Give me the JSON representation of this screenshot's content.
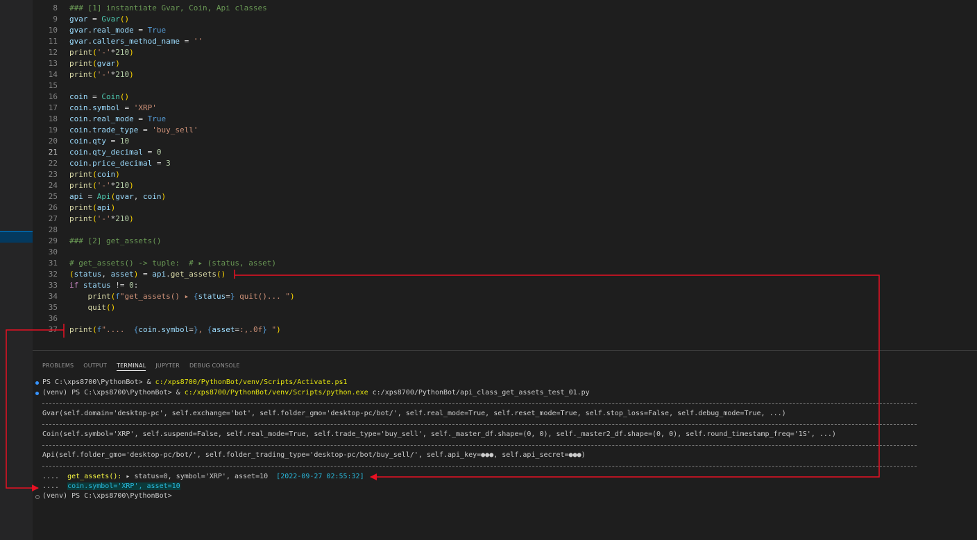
{
  "editor": {
    "active_line": "21",
    "lines": [
      {
        "n": "8",
        "tokens": [
          [
            "c",
            "### [1] instantiate Gvar, Coin, Api classes"
          ]
        ]
      },
      {
        "n": "9",
        "tokens": [
          [
            "v",
            "gvar"
          ],
          [
            "p",
            " = "
          ],
          [
            "cls",
            "Gvar"
          ],
          [
            "y",
            "()"
          ]
        ]
      },
      {
        "n": "10",
        "tokens": [
          [
            "v",
            "gvar"
          ],
          [
            "p",
            "."
          ],
          [
            "v",
            "real_mode"
          ],
          [
            "p",
            " = "
          ],
          [
            "b",
            "True"
          ]
        ]
      },
      {
        "n": "11",
        "tokens": [
          [
            "v",
            "gvar"
          ],
          [
            "p",
            "."
          ],
          [
            "v",
            "callers_method_name"
          ],
          [
            "p",
            " = "
          ],
          [
            "s",
            "''"
          ]
        ]
      },
      {
        "n": "12",
        "tokens": [
          [
            "f",
            "print"
          ],
          [
            "y",
            "("
          ],
          [
            "s",
            "'-'"
          ],
          [
            "p",
            "*"
          ],
          [
            "n",
            "210"
          ],
          [
            "y",
            ")"
          ]
        ]
      },
      {
        "n": "13",
        "tokens": [
          [
            "f",
            "print"
          ],
          [
            "y",
            "("
          ],
          [
            "v",
            "gvar"
          ],
          [
            "y",
            ")"
          ]
        ]
      },
      {
        "n": "14",
        "tokens": [
          [
            "f",
            "print"
          ],
          [
            "y",
            "("
          ],
          [
            "s",
            "'-'"
          ],
          [
            "p",
            "*"
          ],
          [
            "n",
            "210"
          ],
          [
            "y",
            ")"
          ]
        ]
      },
      {
        "n": "15",
        "tokens": []
      },
      {
        "n": "16",
        "tokens": [
          [
            "v",
            "coin"
          ],
          [
            "p",
            " = "
          ],
          [
            "cls",
            "Coin"
          ],
          [
            "y",
            "()"
          ]
        ]
      },
      {
        "n": "17",
        "tokens": [
          [
            "v",
            "coin"
          ],
          [
            "p",
            "."
          ],
          [
            "v",
            "symbol"
          ],
          [
            "p",
            " = "
          ],
          [
            "s",
            "'XRP'"
          ]
        ]
      },
      {
        "n": "18",
        "tokens": [
          [
            "v",
            "coin"
          ],
          [
            "p",
            "."
          ],
          [
            "v",
            "real_mode"
          ],
          [
            "p",
            " = "
          ],
          [
            "b",
            "True"
          ]
        ]
      },
      {
        "n": "19",
        "tokens": [
          [
            "v",
            "coin"
          ],
          [
            "p",
            "."
          ],
          [
            "v",
            "trade_type"
          ],
          [
            "p",
            " = "
          ],
          [
            "s",
            "'buy_sell'"
          ]
        ]
      },
      {
        "n": "20",
        "tokens": [
          [
            "v",
            "coin"
          ],
          [
            "p",
            "."
          ],
          [
            "v",
            "qty"
          ],
          [
            "p",
            " = "
          ],
          [
            "n",
            "10"
          ]
        ]
      },
      {
        "n": "21",
        "tokens": [
          [
            "v",
            "coin"
          ],
          [
            "p",
            "."
          ],
          [
            "v",
            "qty_decimal"
          ],
          [
            "p",
            " = "
          ],
          [
            "n",
            "0"
          ]
        ]
      },
      {
        "n": "22",
        "tokens": [
          [
            "v",
            "coin"
          ],
          [
            "p",
            "."
          ],
          [
            "v",
            "price_decimal"
          ],
          [
            "p",
            " = "
          ],
          [
            "n",
            "3"
          ]
        ]
      },
      {
        "n": "23",
        "tokens": [
          [
            "f",
            "print"
          ],
          [
            "y",
            "("
          ],
          [
            "v",
            "coin"
          ],
          [
            "y",
            ")"
          ]
        ]
      },
      {
        "n": "24",
        "tokens": [
          [
            "f",
            "print"
          ],
          [
            "y",
            "("
          ],
          [
            "s",
            "'-'"
          ],
          [
            "p",
            "*"
          ],
          [
            "n",
            "210"
          ],
          [
            "y",
            ")"
          ]
        ]
      },
      {
        "n": "25",
        "tokens": [
          [
            "v",
            "api"
          ],
          [
            "p",
            " = "
          ],
          [
            "cls",
            "Api"
          ],
          [
            "y",
            "("
          ],
          [
            "v",
            "gvar"
          ],
          [
            "p",
            ", "
          ],
          [
            "v",
            "coin"
          ],
          [
            "y",
            ")"
          ]
        ]
      },
      {
        "n": "26",
        "tokens": [
          [
            "f",
            "print"
          ],
          [
            "y",
            "("
          ],
          [
            "v",
            "api"
          ],
          [
            "y",
            ")"
          ]
        ]
      },
      {
        "n": "27",
        "tokens": [
          [
            "f",
            "print"
          ],
          [
            "y",
            "("
          ],
          [
            "s",
            "'-'"
          ],
          [
            "p",
            "*"
          ],
          [
            "n",
            "210"
          ],
          [
            "y",
            ")"
          ]
        ]
      },
      {
        "n": "28",
        "tokens": []
      },
      {
        "n": "29",
        "tokens": [
          [
            "c",
            "### [2] get_assets()"
          ]
        ]
      },
      {
        "n": "30",
        "tokens": []
      },
      {
        "n": "31",
        "tokens": [
          [
            "c",
            "# get_assets() -> tuple:  # ▸ (status, asset)"
          ]
        ]
      },
      {
        "n": "32",
        "tokens": [
          [
            "y",
            "("
          ],
          [
            "v",
            "status"
          ],
          [
            "p",
            ", "
          ],
          [
            "v",
            "asset"
          ],
          [
            "y",
            ")"
          ],
          [
            "p",
            " = "
          ],
          [
            "v",
            "api"
          ],
          [
            "p",
            "."
          ],
          [
            "f",
            "get_assets"
          ],
          [
            "y",
            "()"
          ]
        ]
      },
      {
        "n": "33",
        "tokens": [
          [
            "k",
            "if"
          ],
          [
            "p",
            " "
          ],
          [
            "v",
            "status"
          ],
          [
            "p",
            " != "
          ],
          [
            "n",
            "0"
          ],
          [
            "p",
            ":"
          ]
        ]
      },
      {
        "n": "34",
        "tokens": [
          [
            "p",
            "    "
          ],
          [
            "f",
            "print"
          ],
          [
            "y",
            "("
          ],
          [
            "b",
            "f"
          ],
          [
            "s",
            "\"get_assets() ▸ "
          ],
          [
            "b",
            "{"
          ],
          [
            "v",
            "status"
          ],
          [
            "p",
            "="
          ],
          [
            "b",
            "}"
          ],
          [
            "s",
            " quit()... \""
          ],
          [
            "y",
            ")"
          ]
        ]
      },
      {
        "n": "35",
        "tokens": [
          [
            "p",
            "    "
          ],
          [
            "f",
            "quit"
          ],
          [
            "y",
            "()"
          ]
        ]
      },
      {
        "n": "36",
        "tokens": []
      },
      {
        "n": "37",
        "tokens": [
          [
            "f",
            "print"
          ],
          [
            "y",
            "("
          ],
          [
            "b",
            "f"
          ],
          [
            "s",
            "\"....  "
          ],
          [
            "b",
            "{"
          ],
          [
            "v",
            "coin"
          ],
          [
            "p",
            "."
          ],
          [
            "v",
            "symbol"
          ],
          [
            "p",
            "="
          ],
          [
            "b",
            "}"
          ],
          [
            "s",
            ", "
          ],
          [
            "b",
            "{"
          ],
          [
            "v",
            "asset"
          ],
          [
            "p",
            "="
          ],
          [
            "s",
            ":,.0f"
          ],
          [
            "b",
            "}"
          ],
          [
            "s",
            " \""
          ],
          [
            "y",
            ")"
          ]
        ]
      }
    ]
  },
  "panel": {
    "tabs": [
      {
        "label": "PROBLEMS",
        "active": false
      },
      {
        "label": "OUTPUT",
        "active": false
      },
      {
        "label": "TERMINAL",
        "active": true
      },
      {
        "label": "JUPYTER",
        "active": false
      },
      {
        "label": "DEBUG CONSOLE",
        "active": false
      }
    ]
  },
  "terminal": {
    "line1": {
      "prompt": "PS C:\\xps8700\\PythonBot> & ",
      "cmd": "c:/xps8700/PythonBot/venv/Scripts/Activate.ps1"
    },
    "line2": {
      "prompt": "(venv) PS C:\\xps8700\\PythonBot> & ",
      "cmd": "c:/xps8700/PythonBot/venv/Scripts/python.exe",
      "arg": " c:/xps8700/PythonBot/api_class_get_assets_test_01.py"
    },
    "gvar": "Gvar(self.domain='desktop-pc', self.exchange='bot', self.folder_gmo='desktop-pc/bot/', self.real_mode=True, self.reset_mode=True, self.stop_loss=False, self.debug_mode=True, ...)",
    "coin": "Coin(self.symbol='XRP', self.suspend=False, self.real_mode=True, self.trade_type='buy_sell', self._master_df.shape=(0, 0), self._master2_df.shape=(0, 0), self.round_timestamp_freq='1S', ...)",
    "api": "Api(self.folder_gmo='desktop-pc/bot/', self.folder_trading_type='desktop-pc/bot/buy_sell/', self.api_key=●●●, self.api_secret=●●●)",
    "out1": {
      "dots": "....  ",
      "func": "get_assets():",
      "rest": " ▸ status=0, symbol='XRP', asset=10  ",
      "time": "[2022-09-27 02:55:32]"
    },
    "out2": {
      "dots": "....  ",
      "text": "coin.symbol='XRP', asset=10"
    },
    "final_prompt": "(venv) PS C:\\xps8700\\PythonBot>"
  },
  "colors": {
    "annotation": "#e81123",
    "background": "#1e1e1e"
  }
}
